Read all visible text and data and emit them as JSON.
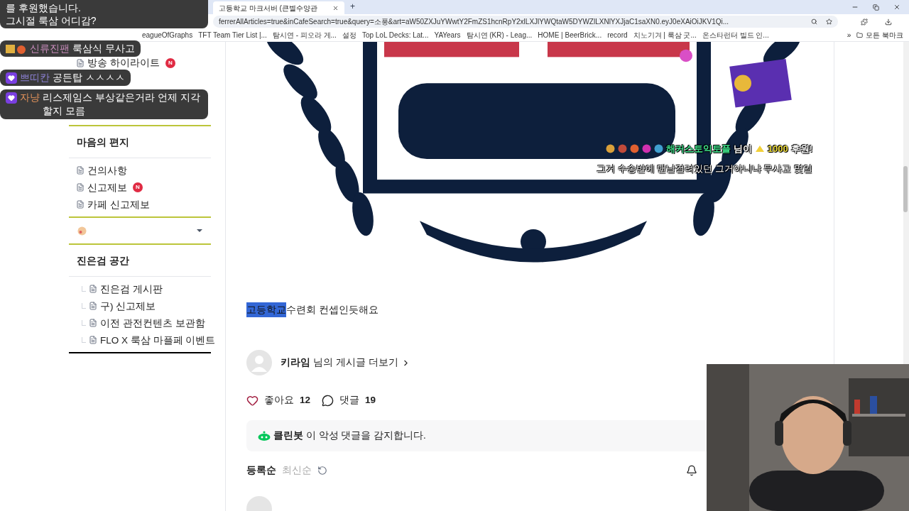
{
  "browser": {
    "tab_title": "고등학교 마크서버 (큰별수양관",
    "new_tab": "+",
    "url": "ferrerAllArticles=true&inCafeSearch=true&query=소풍&art=aW50ZXJuYWwtY2FmZS1hcnRpY2xlLXJlYWQtaW5DYWZlLXNlYXJjaC1saXN0.eyJ0eXAiOiJKV1Qi...",
    "bookmarks": [
      {
        "label": "eagueOfGraphs"
      },
      {
        "label": "TFT Team Tier List |..."
      },
      {
        "label": "탐시연 - 피오라 게..."
      },
      {
        "label": "설정"
      },
      {
        "label": "Top LoL Decks: Lat..."
      },
      {
        "label": "YAYears"
      },
      {
        "label": "탐시연 (KR) - Leag..."
      },
      {
        "label": "HOME | BeerBrick..."
      },
      {
        "label": "record"
      },
      {
        "label": "치노기겨 | 룩삼 굿..."
      },
      {
        "label": "온스타런터 빌드 인..."
      }
    ],
    "more": "»",
    "all_bookmarks": "모든 북마크"
  },
  "sidebar": {
    "top_items": [
      {
        "label": "방송 하이라이트",
        "badge": "N"
      }
    ],
    "sections": [
      {
        "kind": "list",
        "title": "마음의 편지",
        "items": [
          {
            "label": "건의사항"
          },
          {
            "label": "신고제보",
            "badge": "N"
          },
          {
            "label": "카페 신고제보"
          }
        ]
      },
      {
        "kind": "dropdown",
        "expanded": false
      },
      {
        "kind": "tree",
        "title": "진은검 공간",
        "children": [
          {
            "label": "진은검 게시판"
          },
          {
            "label": "구) 신고제보"
          },
          {
            "label": "이전 관전컨텐츠 보관함"
          },
          {
            "label": "FLO X 룩삼 마플페 이벤트"
          }
        ]
      }
    ]
  },
  "article": {
    "picture": {
      "kind": "picture"
    },
    "segments": [
      {
        "text": "고등학교",
        "selected": true
      },
      {
        "text": "수련회 컨셉인듯해요",
        "selected": false
      }
    ],
    "author": {
      "name": "키라임",
      "suffix": "님의 게시글 더보기"
    },
    "reactions": [
      {
        "kind": "like",
        "label": "좋아요",
        "count": "12",
        "selected": false
      },
      {
        "kind": "comment",
        "label": "댓글",
        "count": "19"
      }
    ],
    "cleanbot": {
      "name": "클린봇",
      "text": "이 악성 댓글을 감지합니다."
    },
    "sort": [
      {
        "label": "등록순",
        "selected": true
      },
      {
        "label": "최신순",
        "selected": false
      }
    ]
  },
  "overlays": {
    "donation": [
      "를 후원했습니다.",
      "그시절 룩삼 어디감?"
    ],
    "chat": [
      {
        "kind": "emoji",
        "name": "신류진팬",
        "color": "#c58ab8",
        "text": "룩삼식 무사고"
      },
      {
        "kind": "heart",
        "name": "쁘띠칸",
        "color": "#8a7fd0",
        "text": "공든탑 ㅅㅅㅅㅅ"
      },
      {
        "kind": "heart",
        "name": "자냥",
        "color": "#e0915a",
        "text": "리스제임스 부상같은거라 언제 지각할지 모름"
      }
    ],
    "alert": {
      "sender": "해커스토익토플",
      "suffix": "님이",
      "amount": "1000",
      "suffix2": "후원!",
      "message": "그거 수송반에 맨날걸려있던 그거아니냐 무사고 몇일"
    },
    "webcam": {
      "kind": "picture"
    }
  }
}
